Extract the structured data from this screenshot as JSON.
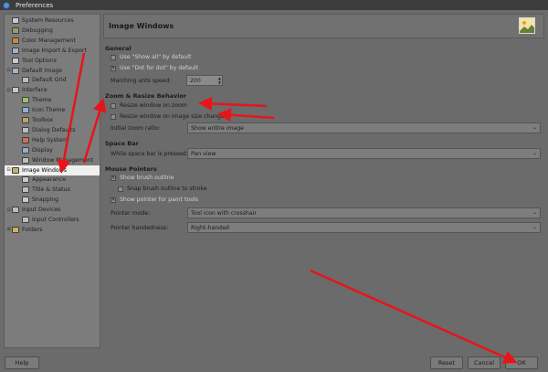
{
  "window": {
    "title": "Preferences"
  },
  "sidebar": {
    "items": [
      {
        "label": "System Resources",
        "indent": 0,
        "expander": "",
        "icon_color": "#c9c9c9"
      },
      {
        "label": "Debugging",
        "indent": 0,
        "expander": "",
        "icon_color": "#8aa36b"
      },
      {
        "label": "Color Management",
        "indent": 0,
        "expander": "",
        "icon_color": "#d0883d"
      },
      {
        "label": "Image Import & Export",
        "indent": 0,
        "expander": "",
        "icon_color": "#a0b3c9"
      },
      {
        "label": "Tool Options",
        "indent": 0,
        "expander": "",
        "icon_color": "#c9c9c9"
      },
      {
        "label": "Default Image",
        "indent": 0,
        "expander": "⊟",
        "icon_color": "#a0b3c9"
      },
      {
        "label": "Default Grid",
        "indent": 1,
        "expander": "",
        "icon_color": "#bdbdbd"
      },
      {
        "label": "Interface",
        "indent": 0,
        "expander": "⊟",
        "icon_color": "#c9c9c9"
      },
      {
        "label": "Theme",
        "indent": 1,
        "expander": "",
        "icon_color": "#9cc26b"
      },
      {
        "label": "Icon Theme",
        "indent": 1,
        "expander": "",
        "icon_color": "#8fb0d0"
      },
      {
        "label": "Toolbox",
        "indent": 1,
        "expander": "",
        "icon_color": "#c0a070"
      },
      {
        "label": "Dialog Defaults",
        "indent": 1,
        "expander": "",
        "icon_color": "#bdbdbd"
      },
      {
        "label": "Help System",
        "indent": 1,
        "expander": "",
        "icon_color": "#d96a5a"
      },
      {
        "label": "Display",
        "indent": 1,
        "expander": "",
        "icon_color": "#8fb0d0"
      },
      {
        "label": "Window Management",
        "indent": 1,
        "expander": "",
        "icon_color": "#bdbdbd"
      },
      {
        "label": "Image Windows",
        "indent": 0,
        "expander": "⊟",
        "icon_color": "#c9b070",
        "selected": true
      },
      {
        "label": "Appearance",
        "indent": 1,
        "expander": "",
        "icon_color": "#c9c9c9"
      },
      {
        "label": "Title & Status",
        "indent": 1,
        "expander": "",
        "icon_color": "#bdbdbd"
      },
      {
        "label": "Snapping",
        "indent": 1,
        "expander": "",
        "icon_color": "#c9c9c9"
      },
      {
        "label": "Input Devices",
        "indent": 0,
        "expander": "⊟",
        "icon_color": "#bdbdbd"
      },
      {
        "label": "Input Controllers",
        "indent": 1,
        "expander": "",
        "icon_color": "#bdbdbd"
      },
      {
        "label": "Folders",
        "indent": 0,
        "expander": "⊞",
        "icon_color": "#d0b060"
      }
    ]
  },
  "main": {
    "title": "Image Windows",
    "general": {
      "heading": "General",
      "show_all": "Use \"Show all\" by default",
      "dot_for_dot": "Use \"Dot for dot\" by default",
      "marching_label": "Marching ants speed:",
      "marching_value": "200"
    },
    "zoom": {
      "heading": "Zoom & Resize Behavior",
      "resize_zoom": "Resize window on zoom",
      "resize_image": "Resize window on image size change",
      "initial_label": "Initial zoom ratio:",
      "initial_value": "Show entire image"
    },
    "spacebar": {
      "heading": "Space Bar",
      "label": "While space bar is pressed:",
      "value": "Pan view"
    },
    "pointers": {
      "heading": "Mouse Pointers",
      "brush_outline": "Show brush outline",
      "snap_outline": "Snap brush outline to stroke",
      "pointer_paint": "Show pointer for paint tools",
      "mode_label": "Pointer mode:",
      "mode_value": "Tool icon with crosshair",
      "hand_label": "Pointer handedness:",
      "hand_value": "Right-handed"
    }
  },
  "buttons": {
    "help": "Help",
    "reset": "Reset",
    "cancel": "Cancel",
    "ok": "OK"
  },
  "colors": {
    "annotation_arrow": "#e8141a",
    "selection": "#f0f0f0"
  }
}
